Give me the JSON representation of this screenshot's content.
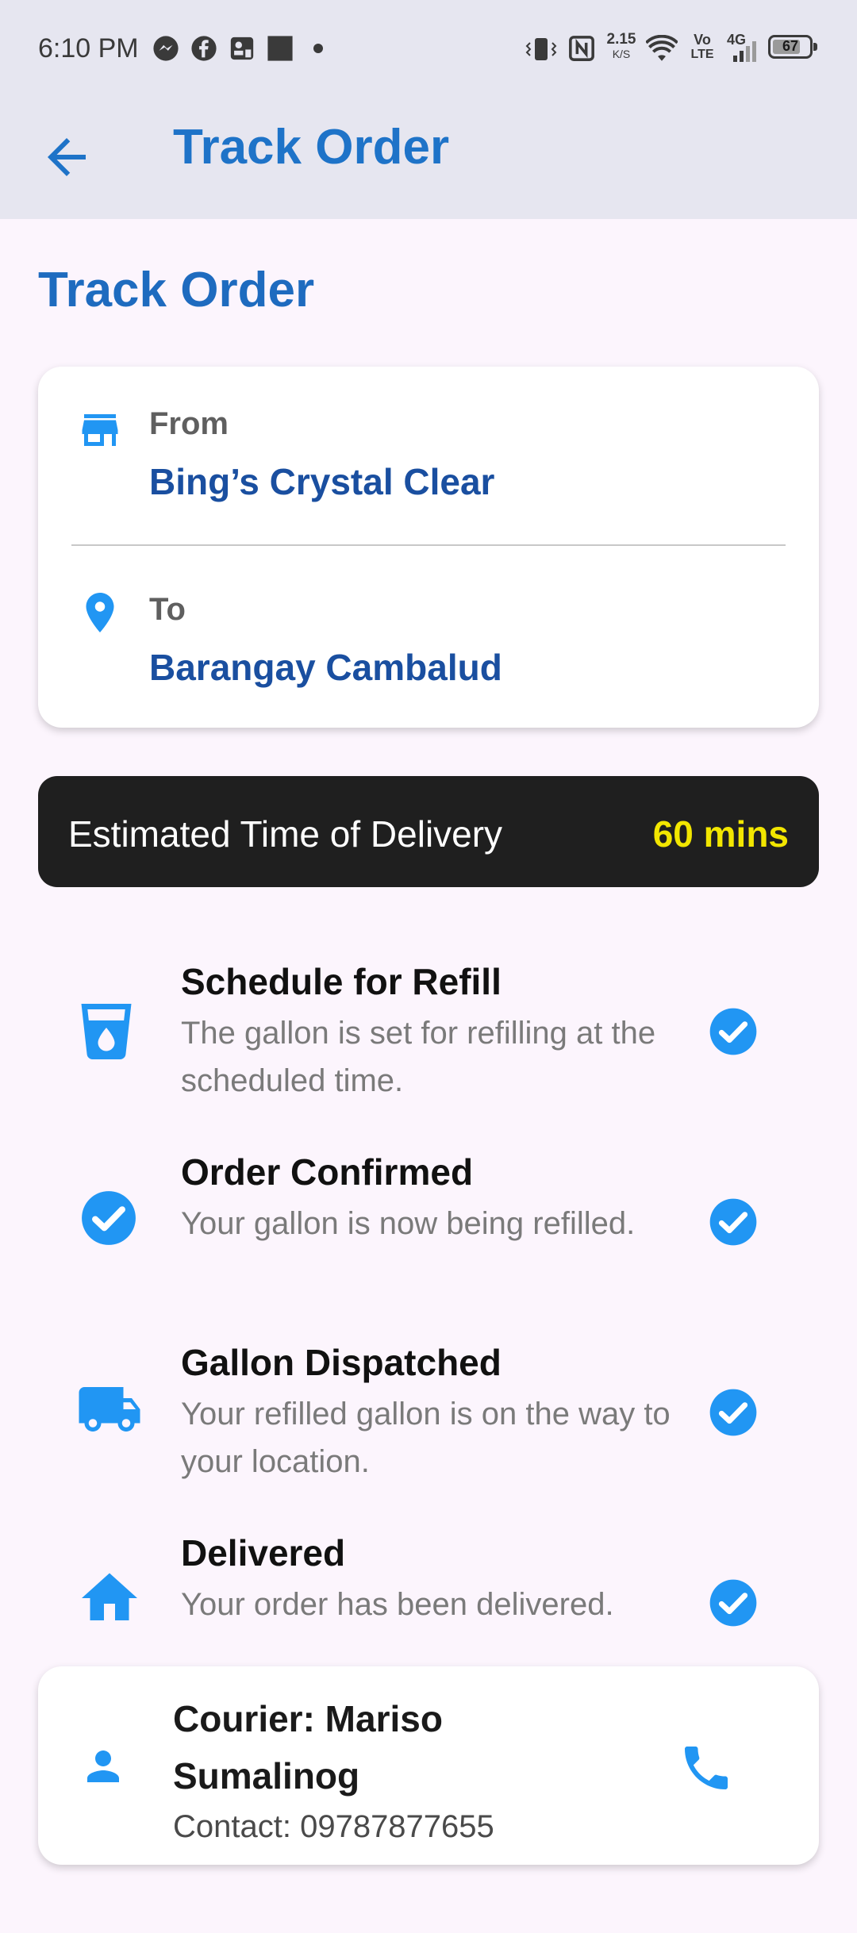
{
  "status_bar": {
    "time": "6:10 PM",
    "network_speed_value": "2.15",
    "network_speed_unit": "K/S",
    "volte_top": "Vo",
    "volte_bottom": "LTE",
    "network_type": "4G",
    "battery": "67",
    "icons": [
      "messenger-icon",
      "facebook-icon",
      "contact-card-icon",
      "square-icon",
      "dot-icon",
      "vibrate-icon",
      "nfc-icon",
      "wifi-icon",
      "signal-icon",
      "battery-icon"
    ]
  },
  "app_bar": {
    "title": "Track Order",
    "back_icon": "arrow-left-icon"
  },
  "page": {
    "title": "Track Order"
  },
  "route": {
    "from_label": "From",
    "from_value": "Bing’s Crystal Clear",
    "to_label": "To",
    "to_value": "Barangay Cambalud",
    "from_icon": "store-icon",
    "to_icon": "location-pin-icon"
  },
  "eta": {
    "label": "Estimated Time of Delivery",
    "value": "60 mins"
  },
  "steps": [
    {
      "title": "Schedule for Refill",
      "description": "The gallon is set for refilling at the scheduled time.",
      "icon": "water-cup-icon",
      "done": true
    },
    {
      "title": "Order Confirmed",
      "description": "Your gallon is now being refilled.",
      "icon": "check-circle-icon",
      "done": true
    },
    {
      "title": "Gallon Dispatched",
      "description": "Your refilled gallon is on the way to your location.",
      "icon": "truck-icon",
      "done": true
    },
    {
      "title": "Delivered",
      "description": "Your order has been delivered.",
      "icon": "home-icon",
      "done": true
    }
  ],
  "courier": {
    "name": "Courier: Mariso Sumalinog",
    "contact": "Contact: 09787877655",
    "icon": "person-icon",
    "call_icon": "phone-icon"
  },
  "colors": {
    "accent": "#1E73C8",
    "icon_blue": "#2196F3",
    "eta_bg": "#1F1F1F",
    "eta_value": "#F2E600",
    "background": "#FCF5FD",
    "app_bar": "#E6E6F0"
  }
}
